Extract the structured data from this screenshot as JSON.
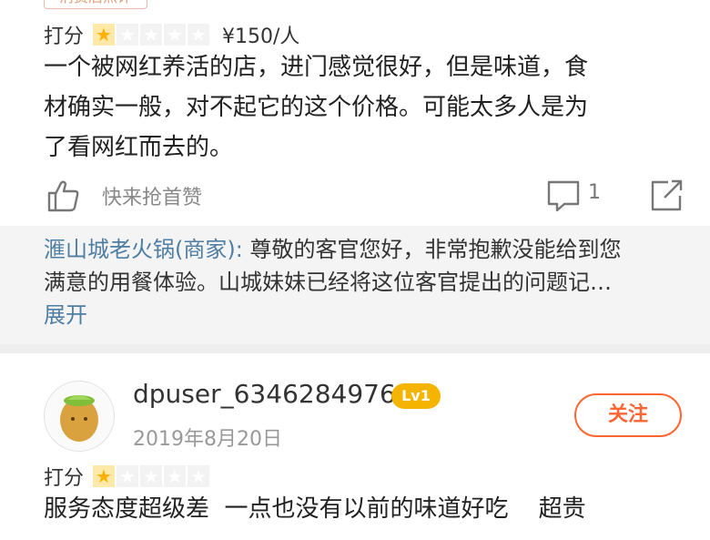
{
  "review1": {
    "tag": "消费后点评",
    "rating_label": "打分",
    "stars_filled": 1,
    "stars_total": 5,
    "price": "¥150/人",
    "text_lines": [
      "一个被网红养活的店，进门感觉很好，但是味道，食",
      "材确实一般，对不起它的这个价格。可能太多人是为",
      "了看网红而去的。"
    ],
    "like_label": "快来抢首赞",
    "comment_count": "1",
    "merchant_reply": {
      "name": "滙山城老火锅(商家):",
      "text_lines": [
        " 尊敬的客官您好，非常抱歉没能给到您",
        "满意的用餐体验。山城妹妹已经将这位客官提出的问题记…"
      ],
      "expand_label": "展开"
    }
  },
  "review2": {
    "username": "dpuser_6346284976",
    "level": "Lv1",
    "date": "2019年8月20日",
    "follow_label": "关注",
    "rating_label": "打分",
    "stars_filled": 1,
    "stars_total": 5,
    "text": "服务态度超级差  一点也没有以前的味道好吃    超贵"
  },
  "colors": {
    "star_active": "#ffb000",
    "link_blue": "#4f7ea3",
    "follow_orange": "#ff6633",
    "level_badge": "#f5b400"
  },
  "icons": [
    "star-icon",
    "like-icon",
    "comment-icon",
    "share-icon",
    "avatar-icon"
  ]
}
